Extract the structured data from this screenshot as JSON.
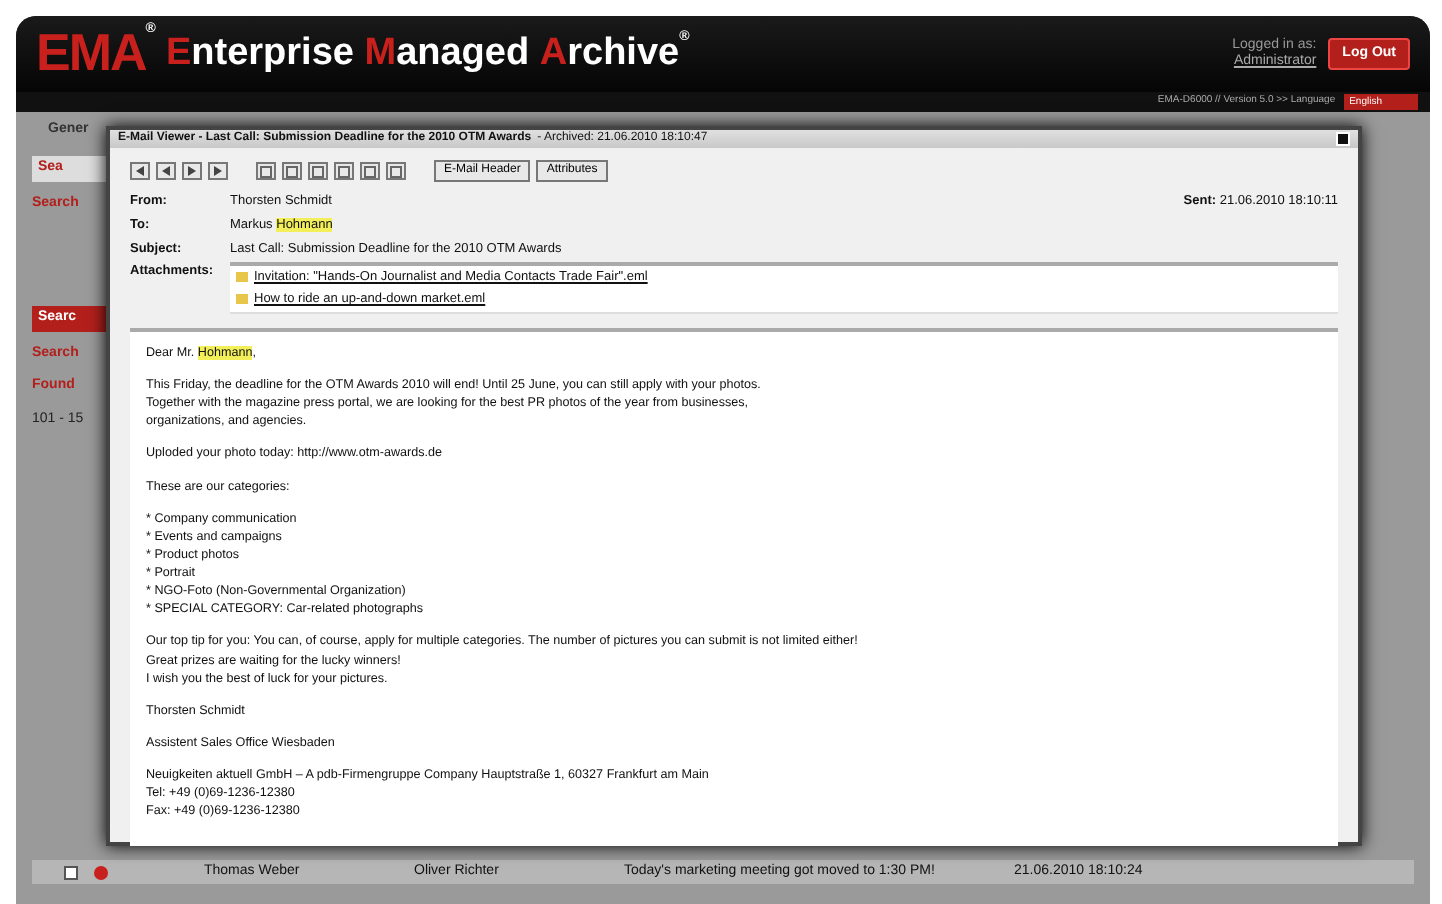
{
  "header": {
    "logo_mark": "EMA",
    "logo_mark_reg": "®",
    "title_words": [
      {
        "initial": "E",
        "rest": "nterprise"
      },
      {
        "initial": "M",
        "rest": "anaged"
      },
      {
        "initial": "A",
        "rest": "rchive"
      }
    ],
    "title_reg": "®",
    "login_label": "Logged in as:",
    "login_user": "Administrator",
    "logout": "Log Out",
    "version": "EMA-D6000 // Version 5.0 >> Language",
    "language": "English"
  },
  "background": {
    "tab": "Gener",
    "fragments": [
      {
        "kind": "tab",
        "text": "Sea"
      },
      {
        "kind": "heading",
        "text": "Search"
      },
      {
        "kind": "button",
        "text": "Searc"
      },
      {
        "kind": "heading",
        "text": "Search"
      },
      {
        "kind": "heading",
        "text": "Found"
      },
      {
        "kind": "text",
        "text": "101 - 15"
      }
    ],
    "rows": [
      {
        "checked": false,
        "sender": "Thomas Weber",
        "recipient": "Oliver Richter",
        "subject": "Today's marketing meeting got moved to 1:30 PM!",
        "date": "21.06.2010 18:10:24"
      }
    ]
  },
  "viewer": {
    "title": "E-Mail Viewer - Last Call: Submission Deadline for the 2010 OTM Awards",
    "archived": "- Archived: 21.06.2010 18:10:47",
    "buttons": [
      "E-Mail Header",
      "Attributes"
    ],
    "fields": [
      {
        "label": "From:",
        "parts": [
          {
            "text": "Thorsten Schmidt",
            "highlight": false
          }
        ]
      },
      {
        "label": "To:",
        "parts": [
          {
            "text": "Markus ",
            "highlight": false
          },
          {
            "text": "Hohmann",
            "highlight": true
          }
        ]
      },
      {
        "label": "Subject:",
        "parts": [
          {
            "text": "Last Call: Submission Deadline for the 2010 OTM Awards",
            "highlight": false
          }
        ]
      }
    ],
    "sent_label": "Sent:",
    "sent": "21.06.2010 18:10:11",
    "attachments_label": "Attachments:",
    "attachments": [
      "Invitation: \"Hands-On Journalist and Media Contacts Trade Fair\".eml",
      "How to ride an up-and-down market.eml"
    ],
    "body": [
      [
        {
          "parts": [
            {
              "text": "Dear Mr. ",
              "highlight": false
            },
            {
              "text": "Hohmann",
              "highlight": true
            },
            {
              "text": ",",
              "highlight": false
            }
          ]
        }
      ],
      [
        {
          "parts": [
            {
              "text": "This Friday, the deadline for the OTM Awards 2010 will end! Until 25 June, you can still apply with your photos.",
              "highlight": false
            }
          ]
        },
        {
          "parts": [
            {
              "text": "Together with the magazine press portal, we are looking for the best PR photos of the year from businesses,",
              "highlight": false
            }
          ]
        },
        {
          "parts": [
            {
              "text": "organizations, and agencies.",
              "highlight": false
            }
          ]
        }
      ],
      [
        {
          "parts": [
            {
              "text": "Uploded your photo today: http://www.otm-awards.de",
              "highlight": false
            }
          ]
        }
      ],
      [
        {
          "parts": [
            {
              "text": "These are our categories:",
              "highlight": false
            }
          ]
        }
      ],
      [
        {
          "parts": [
            {
              "text": "* Company communication",
              "highlight": false
            }
          ]
        },
        {
          "parts": [
            {
              "text": "* Events and campaigns",
              "highlight": false
            }
          ]
        },
        {
          "parts": [
            {
              "text": "* Product photos",
              "highlight": false
            }
          ]
        },
        {
          "parts": [
            {
              "text": "* Portrait",
              "highlight": false
            }
          ]
        },
        {
          "parts": [
            {
              "text": "* NGO-Foto (Non-Governmental Organization)",
              "highlight": false
            }
          ]
        },
        {
          "parts": [
            {
              "text": "* SPECIAL CATEGORY: Car-related photographs",
              "highlight": false
            }
          ]
        }
      ],
      [
        {
          "parts": [
            {
              "text": "Our top tip for you: You can, of course, apply for multiple categories. The number of pictures you can submit is not limited either!",
              "highlight": false
            }
          ]
        },
        {
          "parts": [
            {
              "text": "Great prizes are waiting for the lucky winners!",
              "highlight": false
            }
          ]
        },
        {
          "parts": [
            {
              "text": "I wish you the best of luck for your pictures.",
              "highlight": false
            }
          ]
        }
      ],
      [
        {
          "parts": [
            {
              "text": "Thorsten Schmidt",
              "highlight": false
            }
          ]
        }
      ],
      [
        {
          "parts": [
            {
              "text": "Assistent Sales Office Wiesbaden",
              "highlight": false
            }
          ]
        }
      ],
      [
        {
          "parts": [
            {
              "text": "Neuigkeiten aktuell GmbH – A pdb-Firmengruppe Company Hauptstraße 1, 60327 Frankfurt am Main",
              "highlight": false
            }
          ]
        },
        {
          "parts": [
            {
              "text": "Tel: +49 (0)69-1236-12380",
              "highlight": false
            }
          ]
        },
        {
          "parts": [
            {
              "text": "Fax: +49 (0)69-1236-12380",
              "highlight": false
            }
          ]
        }
      ]
    ]
  }
}
